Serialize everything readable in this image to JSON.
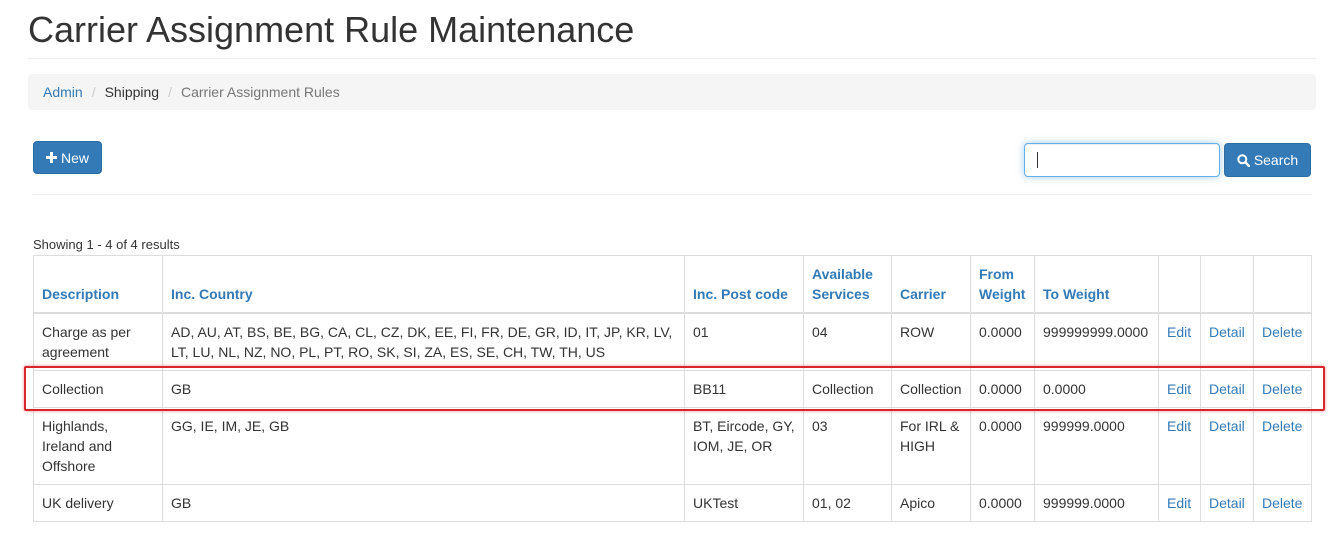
{
  "page": {
    "title": "Carrier Assignment Rule Maintenance"
  },
  "breadcrumb": [
    "Admin",
    "Shipping",
    "Carrier Assignment Rules"
  ],
  "toolbar": {
    "new_label": "New",
    "search_label": "Search",
    "search_value": ""
  },
  "results_text": "Showing 1 - 4 of 4 results",
  "table": {
    "headers": [
      "Description",
      "Inc. Country",
      "Inc. Post code",
      "Available Services",
      "Carrier",
      "From Weight",
      "To Weight",
      "",
      "",
      ""
    ],
    "action_labels": {
      "edit": "Edit",
      "detail": "Detail",
      "delete": "Delete"
    },
    "rows": [
      {
        "description": "Charge as per agreement",
        "country": "AD, AU, AT, BS, BE, BG, CA, CL, CZ, DK, EE, FI, FR, DE, GR, ID, IT, JP, KR, LV, LT, LU, NL, NZ, NO, PL, PT, RO, SK, SI, ZA, ES, SE, CH, TW, TH, US",
        "postcode": "01",
        "services": "04",
        "carrier": "ROW",
        "from_weight": "0.0000",
        "to_weight": "999999999.0000"
      },
      {
        "description": "Collection",
        "country": "GB",
        "postcode": "BB11",
        "services": "Collection",
        "carrier": "Collection",
        "from_weight": "0.0000",
        "to_weight": "0.0000"
      },
      {
        "description": "Highlands, Ireland and Offshore",
        "country": "GG, IE, IM, JE, GB",
        "postcode": "BT, Eircode, GY, IOM, JE, OR",
        "services": "03",
        "carrier": "For IRL & HIGH",
        "from_weight": "0.0000",
        "to_weight": "999999.0000"
      },
      {
        "description": "UK delivery",
        "country": "GB",
        "postcode": "UKTest",
        "services": "01, 02",
        "carrier": "Apico",
        "from_weight": "0.0000",
        "to_weight": "999999.0000"
      }
    ]
  },
  "colors": {
    "primary": "#337ab7",
    "highlight": "#d9262b"
  },
  "icons": {
    "new": "plus-icon",
    "search": "search-icon"
  }
}
